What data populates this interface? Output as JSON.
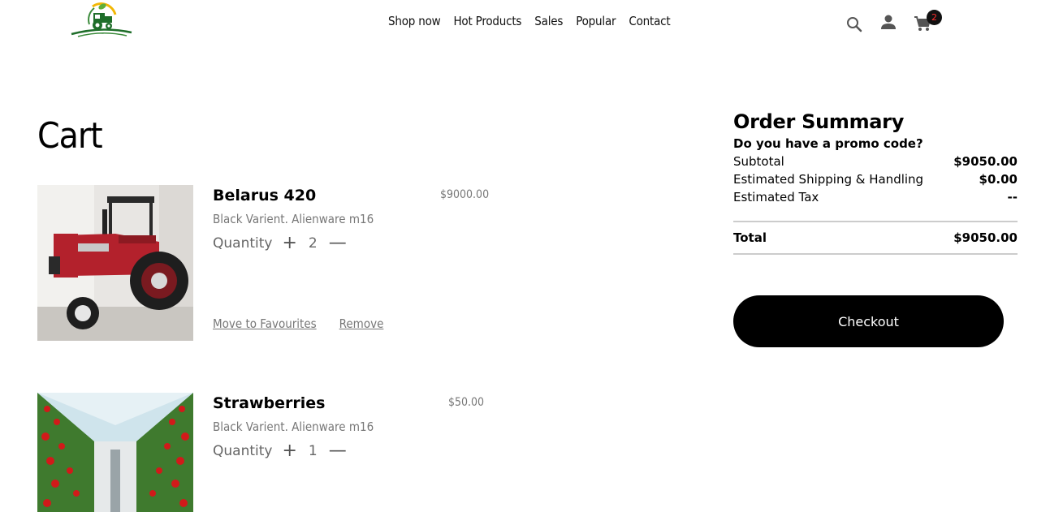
{
  "header": {
    "logo_icon": "tractor-logo-icon",
    "nav": [
      "Shop now",
      "Hot Products",
      "Sales",
      "Popular",
      "Contact"
    ],
    "icons": [
      "search-icon",
      "user-icon",
      "cart-icon"
    ],
    "cart_count": "2",
    "badge_color": "#ff2d2d"
  },
  "cart": {
    "title": "Cart",
    "items": [
      {
        "name": "Belarus 420",
        "variant": "Black Varient. Alienware m16",
        "price": "$9000.00",
        "quantity_label": "Quantity",
        "quantity": "2",
        "plus": "+",
        "minus": "—",
        "move_label": "Move to Favourites",
        "remove_label": "Remove"
      },
      {
        "name": "Strawberries",
        "variant": "Black Varient. Alienware m16",
        "price": "$50.00",
        "quantity_label": "Quantity",
        "quantity": "1",
        "plus": "+",
        "minus": "—"
      }
    ]
  },
  "summary": {
    "title": "Order Summary",
    "promo": "Do you have a promo code?",
    "subtotal_label": "Subtotal",
    "subtotal": "$9050.00",
    "shipping_label": "Estimated Shipping & Handling",
    "shipping": "$0.00",
    "tax_label": "Estimated Tax",
    "tax": "--",
    "total_label": "Total",
    "total": "$9050.00",
    "checkout_label": "Checkout"
  }
}
